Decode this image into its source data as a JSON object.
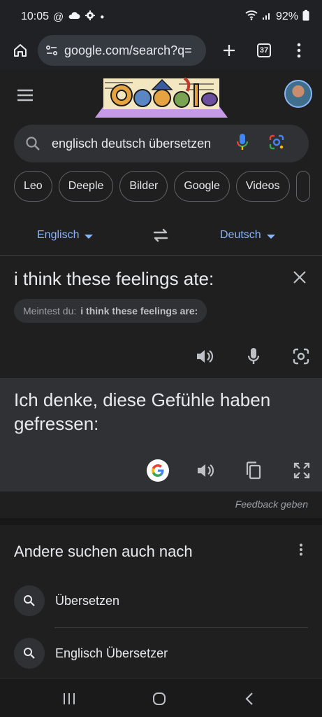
{
  "status": {
    "time": "10:05",
    "notif_icons": [
      "at-icon",
      "cloud-icon",
      "gear-icon",
      "dot-icon"
    ],
    "battery": "92%"
  },
  "browser": {
    "url": "google.com/search?q=",
    "tab_count": "37"
  },
  "search": {
    "query": "englisch deutsch übersetzen"
  },
  "chips": [
    "Leo",
    "Deeple",
    "Bilder",
    "Google",
    "Videos"
  ],
  "translator": {
    "source_lang": "Englisch",
    "target_lang": "Deutsch",
    "source_text": "i think these feelings ate:",
    "did_you_mean_label": "Meintest du:",
    "did_you_mean_value": "i think these feelings are:",
    "target_text": "Ich denke, diese Gefühle haben gefressen:",
    "feedback": "Feedback geben"
  },
  "related": {
    "title": "Andere suchen auch nach",
    "items": [
      "Übersetzen",
      "Englisch Übersetzer"
    ]
  },
  "colors": {
    "accent": "#8ab4f8",
    "background": "#1f1f1f",
    "surface": "#303134"
  }
}
